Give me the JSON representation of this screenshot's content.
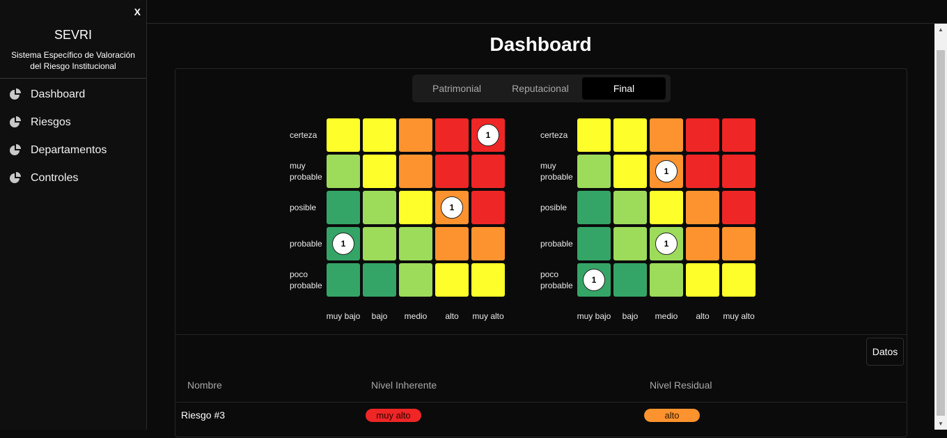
{
  "sidebar": {
    "close": "X",
    "brand": "SEVRI",
    "subtitle": "Sistema Específico de Valoración del Riesgo Institucional",
    "items": [
      {
        "label": "Dashboard",
        "icon": "pie-chart-icon"
      },
      {
        "label": "Riesgos",
        "icon": "pie-chart-icon"
      },
      {
        "label": "Departamentos",
        "icon": "pie-chart-icon"
      },
      {
        "label": "Controles",
        "icon": "pie-chart-icon"
      }
    ]
  },
  "main": {
    "title": "Dashboard",
    "tabs": [
      {
        "label": "Patrimonial",
        "active": false
      },
      {
        "label": "Reputacional",
        "active": false
      },
      {
        "label": "Final",
        "active": true
      }
    ]
  },
  "colors": {
    "dark_green": "#34a566",
    "light_green": "#9ddb5a",
    "yellow": "#fefe2a",
    "orange": "#fd932e",
    "red": "#ee2626"
  },
  "matrices": [
    {
      "row_labels": [
        "certeza",
        "muy probable",
        "posible",
        "probable",
        "poco probable"
      ],
      "col_labels": [
        "muy bajo",
        "bajo",
        "medio",
        "alto",
        "muy alto"
      ],
      "grid": [
        [
          "yellow",
          "yellow",
          "orange",
          "red",
          "red"
        ],
        [
          "light_green",
          "yellow",
          "orange",
          "red",
          "red"
        ],
        [
          "dark_green",
          "light_green",
          "yellow",
          "orange",
          "red"
        ],
        [
          "dark_green",
          "light_green",
          "light_green",
          "orange",
          "orange"
        ],
        [
          "dark_green",
          "dark_green",
          "light_green",
          "yellow",
          "yellow"
        ]
      ],
      "counts": [
        [
          "",
          "",
          "",
          "",
          "1"
        ],
        [
          "",
          "",
          "",
          "",
          ""
        ],
        [
          "",
          "",
          "",
          "1",
          ""
        ],
        [
          "1",
          "",
          "",
          "",
          ""
        ],
        [
          "",
          "",
          "",
          "",
          ""
        ]
      ]
    },
    {
      "row_labels": [
        "certeza",
        "muy probable",
        "posible",
        "probable",
        "poco probable"
      ],
      "col_labels": [
        "muy bajo",
        "bajo",
        "medio",
        "alto",
        "muy alto"
      ],
      "grid": [
        [
          "yellow",
          "yellow",
          "orange",
          "red",
          "red"
        ],
        [
          "light_green",
          "yellow",
          "orange",
          "red",
          "red"
        ],
        [
          "dark_green",
          "light_green",
          "yellow",
          "orange",
          "red"
        ],
        [
          "dark_green",
          "light_green",
          "light_green",
          "orange",
          "orange"
        ],
        [
          "dark_green",
          "dark_green",
          "light_green",
          "yellow",
          "yellow"
        ]
      ],
      "counts": [
        [
          "",
          "",
          "",
          "",
          ""
        ],
        [
          "",
          "",
          "1",
          "",
          ""
        ],
        [
          "",
          "",
          "",
          "",
          ""
        ],
        [
          "",
          "",
          "1",
          "",
          ""
        ],
        [
          "1",
          "",
          "",
          "",
          ""
        ]
      ]
    }
  ],
  "table": {
    "datos_button": "Datos",
    "headers": {
      "name": "Nombre",
      "inherent": "Nivel Inherente",
      "residual": "Nivel Residual"
    },
    "rows": [
      {
        "name": "Riesgo #3",
        "inherent": "muy alto",
        "inherent_color": "#ee2626",
        "residual": "alto",
        "residual_color": "#fd932e"
      }
    ]
  }
}
